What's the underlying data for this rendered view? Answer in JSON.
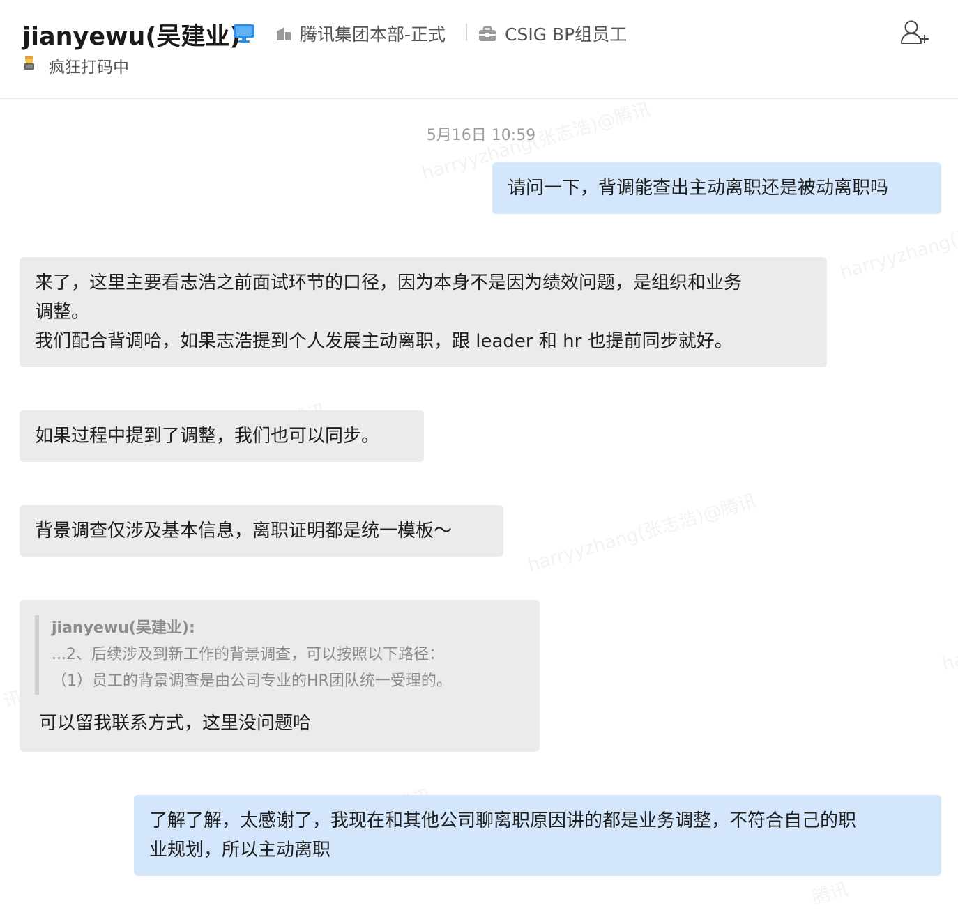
{
  "header": {
    "name": "jianyewu(吴建业)",
    "org": "腾讯集团本部-正式",
    "dept": "CSIG BP组员工",
    "status": "疯狂打码中",
    "icons": {
      "device": "desktop-icon",
      "org": "building-icon",
      "dept": "briefcase-icon",
      "status": "coder-emoji-icon",
      "add_user": "add-user-icon"
    }
  },
  "chat": {
    "timestamp": "5月16日 10:59",
    "messages": [
      {
        "side": "mine",
        "lines": [
          "请问一下，背调能查出主动离职还是被动离职吗"
        ]
      },
      {
        "side": "theirs",
        "lines": [
          "来了，这里主要看志浩之前面试环节的口径，因为本身不是因为绩效问题，是组织和业务",
          "调整。",
          "我们配合背调哈，如果志浩提到个人发展主动离职，跟 leader 和 hr 也提前同步就好。"
        ]
      },
      {
        "side": "theirs",
        "lines": [
          "如果过程中提到了调整，我们也可以同步。"
        ]
      },
      {
        "side": "theirs",
        "lines": [
          "背景调查仅涉及基本信息，离职证明都是统一模板～"
        ]
      },
      {
        "side": "theirs",
        "quote": {
          "author": "jianyewu(吴建业):",
          "lines": [
            "...2、后续涉及到新工作的背景调查，可以按照以下路径：",
            "（1）员工的背景调查是由公司专业的HR团队统一受理的。"
          ]
        },
        "reply": "可以留我联系方式，这里没问题哈"
      },
      {
        "side": "mine",
        "lines": [
          "了解了解，太感谢了，我现在和其他公司聊离职原因讲的都是业务调整，不符合自己的职",
          "业规划，所以主动离职"
        ]
      }
    ]
  },
  "watermarks": [
    "harryyzhang(张志浩)@腾讯",
    "harryyzhang(张",
    "h)@腾讯",
    "harryyzhang(张志浩)@腾讯",
    "ha",
    "讯",
    "腾讯",
    "腾讯"
  ],
  "colors": {
    "mine_bubble": "#d3e6fb",
    "theirs_bubble": "#ebebeb"
  }
}
